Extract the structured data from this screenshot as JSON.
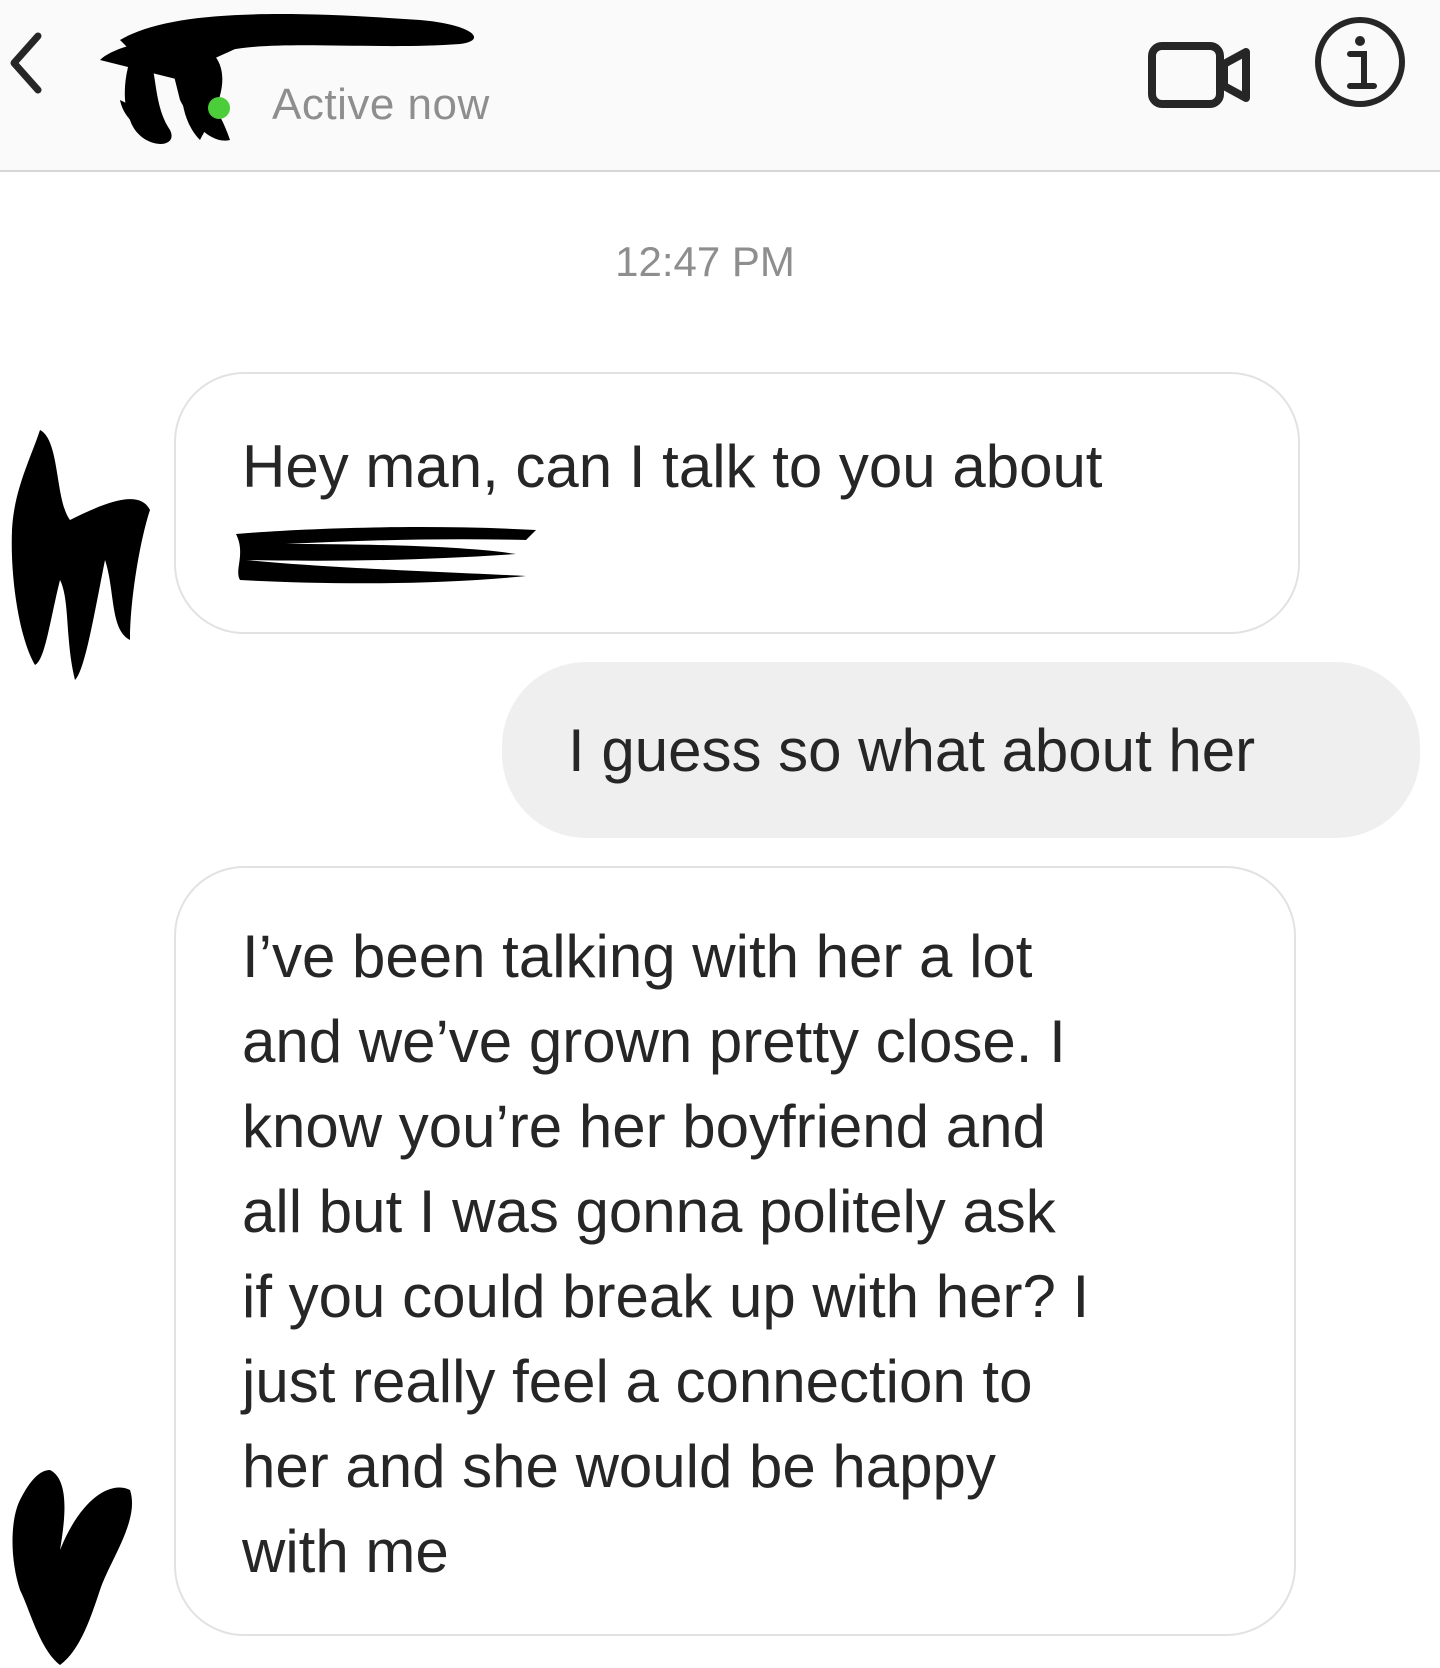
{
  "header": {
    "back_icon": "chevron-left-icon",
    "status_text": "Active now",
    "status_color": "#4ccd3a",
    "video_icon": "video-camera-icon",
    "info_icon": "info-icon"
  },
  "conversation": {
    "timestamp": "12:47 PM",
    "messages": [
      {
        "sender": "other",
        "text": "Hey man, can I talk to you about"
      },
      {
        "sender": "me",
        "text": "I guess so what about her"
      },
      {
        "sender": "other",
        "text": "I’ve been talking with her a lot\nand we’ve grown pretty close. I\nknow you’re her boyfriend and\nall but I was gonna politely ask\nif you could break up with her? I\njust really feel a connection to\nher and she would be happy\nwith me"
      }
    ]
  },
  "colors": {
    "incoming_bubble": "#ffffff",
    "outgoing_bubble": "#efefef",
    "text": "#262626",
    "muted_text": "#8e8e8e"
  }
}
